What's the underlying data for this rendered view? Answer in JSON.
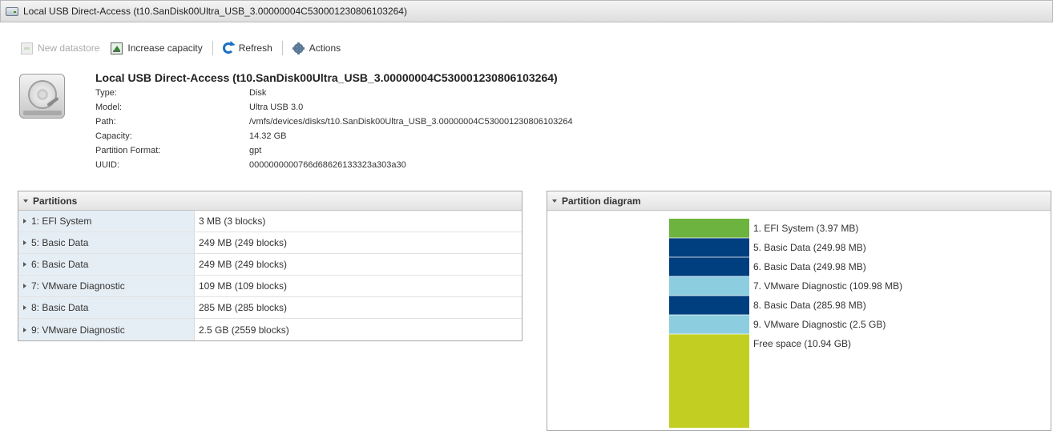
{
  "window": {
    "title": "Local USB Direct-Access (t10.SanDisk00Ultra_USB_3.00000004C530001230806103264)",
    "icon": "usb-disk-icon"
  },
  "toolbar": {
    "new_datastore": "New datastore",
    "increase_capacity": "Increase capacity",
    "refresh": "Refresh",
    "actions": "Actions"
  },
  "device": {
    "title": "Local USB Direct-Access (t10.SanDisk00Ultra_USB_3.00000004C530001230806103264)",
    "icon": "hard-disk-icon",
    "properties": [
      {
        "label": "Type:",
        "value": "Disk"
      },
      {
        "label": "Model:",
        "value": "Ultra USB 3.0"
      },
      {
        "label": "Path:",
        "value": "/vmfs/devices/disks/t10.SanDisk00Ultra_USB_3.00000004C530001230806103264"
      },
      {
        "label": "Capacity:",
        "value": "14.32 GB"
      },
      {
        "label": "Partition Format:",
        "value": "gpt"
      },
      {
        "label": "UUID:",
        "value": "0000000000766d68626133323a303a30"
      }
    ]
  },
  "partitions": {
    "title": "Partitions",
    "rows": [
      {
        "name": "1: EFI System",
        "size": "3 MB (3 blocks)"
      },
      {
        "name": "5: Basic Data",
        "size": "249 MB (249 blocks)"
      },
      {
        "name": "6: Basic Data",
        "size": "249 MB (249 blocks)"
      },
      {
        "name": "7: VMware Diagnostic",
        "size": "109 MB (109 blocks)"
      },
      {
        "name": "8: Basic Data",
        "size": "285 MB (285 blocks)"
      },
      {
        "name": "9: VMware Diagnostic",
        "size": "2.5 GB (2559 blocks)"
      }
    ]
  },
  "diagram": {
    "title": "Partition diagram",
    "segments": [
      {
        "label": "1. EFI System",
        "size": "(3.97 MB)",
        "color": "#6db33f",
        "weight": 1
      },
      {
        "label": "5. Basic Data",
        "size": "(249.98 MB)",
        "color": "#003f7f",
        "weight": 1
      },
      {
        "label": "6. Basic Data",
        "size": "(249.98 MB)",
        "color": "#003f7f",
        "weight": 1
      },
      {
        "label": "7. VMware Diagnostic",
        "size": "(109.98 MB)",
        "color": "#8ccde0",
        "weight": 1
      },
      {
        "label": "8. Basic Data",
        "size": "(285.98 MB)",
        "color": "#003f7f",
        "weight": 1
      },
      {
        "label": "9. VMware Diagnostic",
        "size": "(2.5 GB)",
        "color": "#8ccde0",
        "weight": 1
      },
      {
        "label": "Free space",
        "size": "(10.94 GB)",
        "color": "#c2cf22",
        "weight": 5
      }
    ]
  }
}
